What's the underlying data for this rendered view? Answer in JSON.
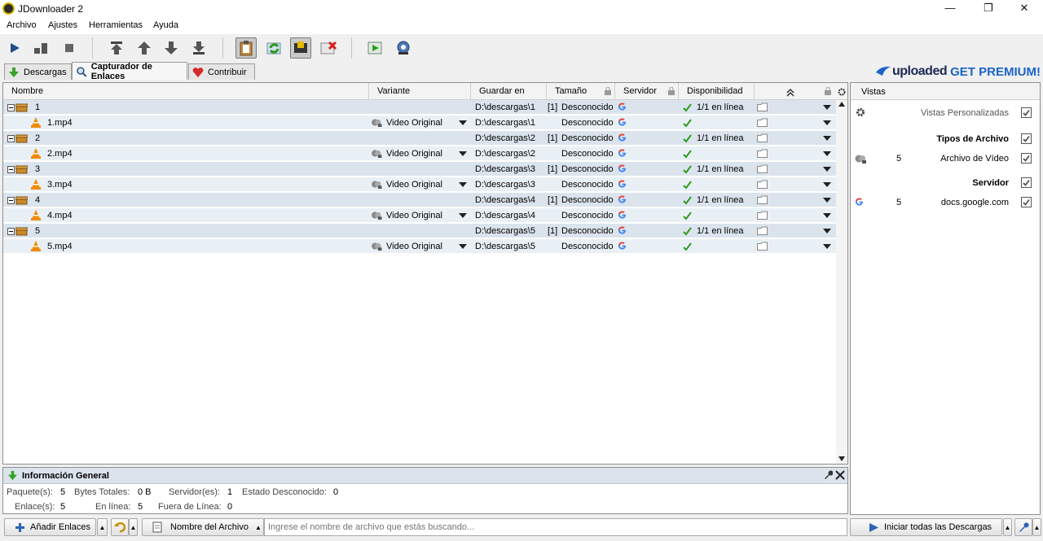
{
  "window": {
    "title": "JDownloader 2",
    "minimize_glyph": "—",
    "maximize_glyph": "❐",
    "close_glyph": "✕"
  },
  "menu": [
    "Archivo",
    "Ajustes",
    "Herramientas",
    "Ayuda"
  ],
  "toolbar_icons": [
    "play-icon",
    "pause-icon",
    "stop-icon",
    "move-top-icon",
    "move-up-icon",
    "move-down-icon",
    "move-bottom-icon",
    "clipboard-observer-icon",
    "auto-reconnect-icon",
    "premium-toggle-icon",
    "silent-mode-icon",
    "update-icon",
    "reconnect-icon"
  ],
  "tabs": [
    {
      "label": "Descargas",
      "icon": "download-arrow-icon"
    },
    {
      "label": "Capturador de Enlaces",
      "icon": "magnifier-icon"
    },
    {
      "label": "Contribuir",
      "icon": "heart-icon"
    }
  ],
  "premium": {
    "brand": "uploaded",
    "cta": "GET PREMIUM!"
  },
  "columns": {
    "name": "Nombre",
    "variant": "Variante",
    "save_to": "Guardar en",
    "size": "Tamaño",
    "host": "Servidor",
    "availability": "Disponibilidad"
  },
  "packages": [
    {
      "name": "1",
      "save_to": "D:\\descargas\\1",
      "count": "[1]",
      "size": "Desconocido",
      "availability": "1/1 en línea",
      "link": {
        "name": "1.mp4",
        "variant": "Video Original",
        "save_to": "D:\\descargas\\1",
        "size": "Desconocido"
      }
    },
    {
      "name": "2",
      "save_to": "D:\\descargas\\2",
      "count": "[1]",
      "size": "Desconocido",
      "availability": "1/1 en línea",
      "link": {
        "name": "2.mp4",
        "variant": "Video Original",
        "save_to": "D:\\descargas\\2",
        "size": "Desconocido"
      }
    },
    {
      "name": "3",
      "save_to": "D:\\descargas\\3",
      "count": "[1]",
      "size": "Desconocido",
      "availability": "1/1 en línea",
      "link": {
        "name": "3.mp4",
        "variant": "Video Original",
        "save_to": "D:\\descargas\\3",
        "size": "Desconocido"
      }
    },
    {
      "name": "4",
      "save_to": "D:\\descargas\\4",
      "count": "[1]",
      "size": "Desconocido",
      "availability": "1/1 en línea",
      "link": {
        "name": "4.mp4",
        "variant": "Video Original",
        "save_to": "D:\\descargas\\4",
        "size": "Desconocido"
      }
    },
    {
      "name": "5",
      "save_to": "D:\\descargas\\5",
      "count": "[1]",
      "size": "Desconocido",
      "availability": "1/1 en línea",
      "link": {
        "name": "5.mp4",
        "variant": "Video Original",
        "save_to": "D:\\descargas\\5",
        "size": "Desconocido"
      }
    }
  ],
  "info": {
    "title": "Información General",
    "packages_label": "Paquete(s):",
    "packages_value": "5",
    "bytes_label": "Bytes Totales:",
    "bytes_value": "0 B",
    "hosts_label": "Servidor(es):",
    "hosts_value": "1",
    "unknown_label": "Estado Desconocido:",
    "unknown_value": "0",
    "links_label": "Enlace(s):",
    "links_value": "5",
    "online_label": "En línea:",
    "online_value": "5",
    "offline_label": "Fuera de Línea:",
    "offline_value": "0"
  },
  "vistas": {
    "title": "Vistas",
    "custom_label": "Vistas Personalizadas",
    "filetypes_label": "Tipos de Archivo",
    "video_count": "5",
    "video_label": "Archivo de Vídeo",
    "host_label": "Servidor",
    "google_count": "5",
    "google_label": "docs.google.com"
  },
  "bottom": {
    "add_links": "Añadir Enlaces",
    "search_mode": "Nombre del Archivo",
    "search_placeholder": "Ingrese el nombre de archivo que estás buscando...",
    "start_all": "Iniciar todas las Descargas"
  },
  "colors": {
    "package_row": "#dbe4ec",
    "link_row": "#e9f0f5",
    "check_green": "#2f9a1f",
    "premium_blue": "#1a64c8"
  }
}
